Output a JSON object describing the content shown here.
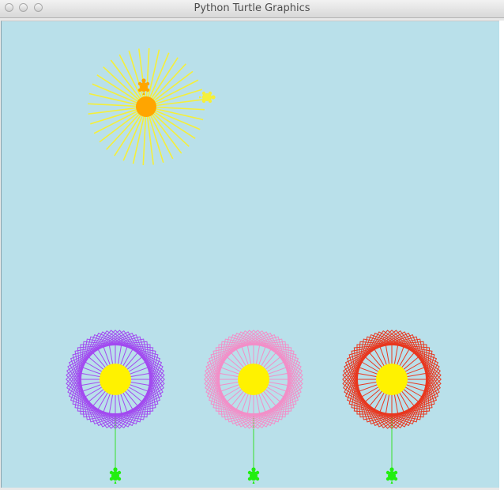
{
  "window": {
    "title": "Python Turtle Graphics"
  },
  "canvas": {
    "background_color": "#b9e0ea"
  },
  "sun": {
    "ray_color": "#f5ef3a",
    "center_color": "#ffa500",
    "turtles": [
      "orange-turtle-icon",
      "yellow-turtle-icon"
    ]
  },
  "flowers": [
    {
      "name": "purple",
      "petal_color": "#a24af0",
      "center_color": "#fff200",
      "stem_color": "#36e02a"
    },
    {
      "name": "pink",
      "petal_color": "#f28fc8",
      "center_color": "#fff200",
      "stem_color": "#36e02a"
    },
    {
      "name": "red",
      "petal_color": "#e8371f",
      "center_color": "#fff200",
      "stem_color": "#36e02a"
    }
  ],
  "turtle_color": "#22ee10"
}
